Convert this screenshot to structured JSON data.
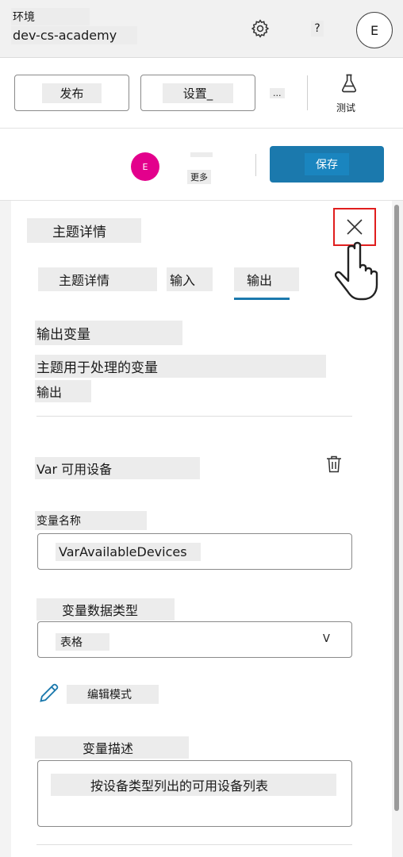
{
  "header": {
    "env_label": "环境",
    "env_name": "dev-cs-academy",
    "help": "?",
    "avatar_initial": "E"
  },
  "commands": {
    "publish": "发布",
    "settings": "设置_",
    "ellipsis": "...",
    "test": "测试"
  },
  "actions": {
    "avatar_initial": "E",
    "more": "更多",
    "save": "保存"
  },
  "panel": {
    "title": "主题详情",
    "tabs": [
      {
        "label": "主题详情"
      },
      {
        "label": "输入"
      },
      {
        "label": "输出"
      }
    ],
    "output_title": "输出变量",
    "output_desc": "主题用于处理的变量",
    "output_desc2": "输出",
    "variable": {
      "title": "Var 可用设备",
      "name_label": "变量名称",
      "name_value": "VarAvailableDevices",
      "type_label": "变量数据类型",
      "type_value": "表格",
      "type_chevron": "V",
      "edit_mode": "编辑模式",
      "desc_label": "变量描述",
      "desc_value": "按设备类型列出的可用设备列表"
    }
  },
  "colors": {
    "accent": "#1b79ad",
    "avatar": "#e3008c",
    "highlight": "#e01e1e"
  }
}
